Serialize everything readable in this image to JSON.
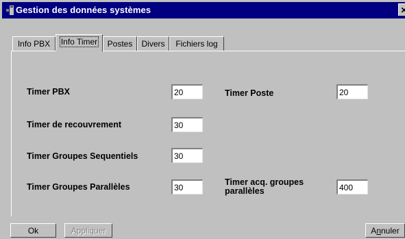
{
  "window": {
    "title": "Gestion des données systèmes",
    "close_label": "✕"
  },
  "tabs": [
    {
      "label": "Info PBX"
    },
    {
      "label": "Info Timer"
    },
    {
      "label": "Postes"
    },
    {
      "label": "Divers"
    },
    {
      "label": "Fichiers log"
    }
  ],
  "fields": {
    "timer_pbx": {
      "label": "Timer PBX",
      "value": "20"
    },
    "timer_poste": {
      "label": "Timer Poste",
      "value": "20"
    },
    "timer_recouvrement": {
      "label": "Timer de recouvrement",
      "value": "30"
    },
    "timer_groupes_sequentiels": {
      "label": "Timer Groupes Sequentiels",
      "value": "30"
    },
    "timer_groupes_paralleles": {
      "label": "Timer Groupes Parallèles",
      "value": "30"
    },
    "timer_acq_groupes_paralleles": {
      "label": "Timer acq. groupes parallèles",
      "value": "400"
    }
  },
  "buttons": {
    "ok": "Ok",
    "apply": "Appliquer",
    "cancel_prefix": "A",
    "cancel_underlined": "n",
    "cancel_suffix": "nuler"
  },
  "colors": {
    "window_bg": "#c0c0c0",
    "titlebar_bg": "#000080",
    "titlebar_text": "#ffffff"
  }
}
